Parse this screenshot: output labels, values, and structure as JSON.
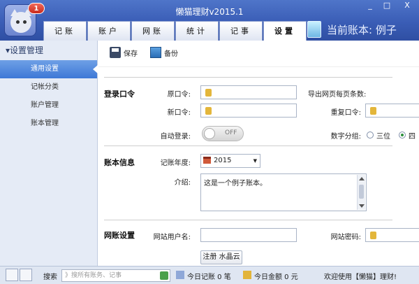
{
  "app": {
    "title": "懒猫理财v2015.1",
    "badge_count": "1"
  },
  "window": {
    "minimize": "_",
    "maximize": "□",
    "close": "X"
  },
  "tabs": [
    {
      "label": "记账"
    },
    {
      "label": "账户"
    },
    {
      "label": "网账"
    },
    {
      "label": "统计"
    },
    {
      "label": "记事"
    },
    {
      "label": "设置"
    }
  ],
  "current_account_label": "当前账本: 例子",
  "sidebar": {
    "header": "▾设置管理",
    "items": [
      {
        "label": "通用设置"
      },
      {
        "label": "记帐分类"
      },
      {
        "label": "账户管理"
      },
      {
        "label": "账本管理"
      }
    ]
  },
  "toolbar": {
    "save_label": "保存",
    "backup_label": "备份"
  },
  "login": {
    "section_title": "登录口令",
    "old_password_label": "原口令:",
    "new_password_label": "新口令:",
    "auto_login_label": "自动登录:",
    "auto_login_state": "OFF",
    "export_rows_label": "导出网页每页条数:",
    "repeat_password_label": "重复口令:",
    "digit_group_label": "数字分组:",
    "digit_options": [
      "三位",
      "四"
    ]
  },
  "book": {
    "section_title": "账本信息",
    "year_label": "记账年度:",
    "year_value": "2015",
    "intro_label": "介绍:",
    "intro_value": "这是一个例子账本。"
  },
  "web": {
    "section_title": "网账设置",
    "username_label": "网站用户名:",
    "password_label": "网站密码:",
    "register_button": "注册 水晶云"
  },
  "statusbar": {
    "search_label": "搜索",
    "search_placeholder": "》搜所有账务、记事",
    "today_records": "今日记账 0 笔",
    "today_amount": "今日金额 0 元",
    "welcome": "欢迎使用【懒猫】理财!"
  },
  "colors": {
    "accent": "#3d78d6",
    "titlebar": "#3a5db6"
  }
}
